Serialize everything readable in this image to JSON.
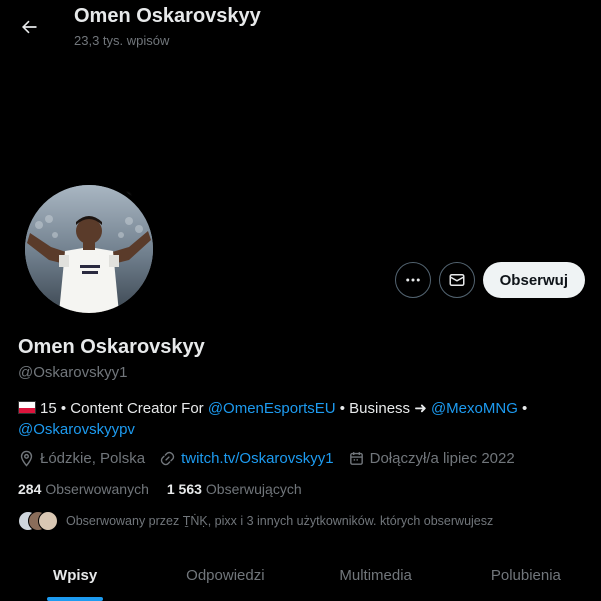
{
  "header": {
    "back_icon": "arrow-left-icon",
    "title": "Omen Oskarovskyy",
    "subtitle": "23,3 tys. wpisów"
  },
  "actions": {
    "more_icon": "more-dots-icon",
    "message_icon": "envelope-icon",
    "follow_label": "Obserwuj"
  },
  "profile": {
    "name": "Omen Oskarovskyy",
    "handle": "@Oskarovskyy1",
    "bio": {
      "prefix": "15 • Content Creator For ",
      "mention1": "@OmenEsportsEU",
      "middle": " • Business ➜ ",
      "mention2": "@MexoMNG",
      "suffix": " • ",
      "mention3": "@Oskarovskyypv"
    },
    "location": "Łódzkie, Polska",
    "website": "twitch.tv/Oskarovskyy1",
    "joined": "Dołączył/a lipiec 2022"
  },
  "stats": {
    "following_count": "284",
    "following_label": "Obserwowanych",
    "followers_count": "1 563",
    "followers_label": "Obserwujących"
  },
  "followed_by": "Obserwowany przez ṮṄḲ, pixx i 3 innych użytkowników. których obserwujesz",
  "tabs": [
    {
      "label": "Wpisy",
      "active": true
    },
    {
      "label": "Odpowiedzi",
      "active": false
    },
    {
      "label": "Multimedia",
      "active": false
    },
    {
      "label": "Polubienia",
      "active": false
    }
  ],
  "colors": {
    "accent": "#1d9bf0",
    "background": "#000000",
    "muted": "#71767b"
  }
}
